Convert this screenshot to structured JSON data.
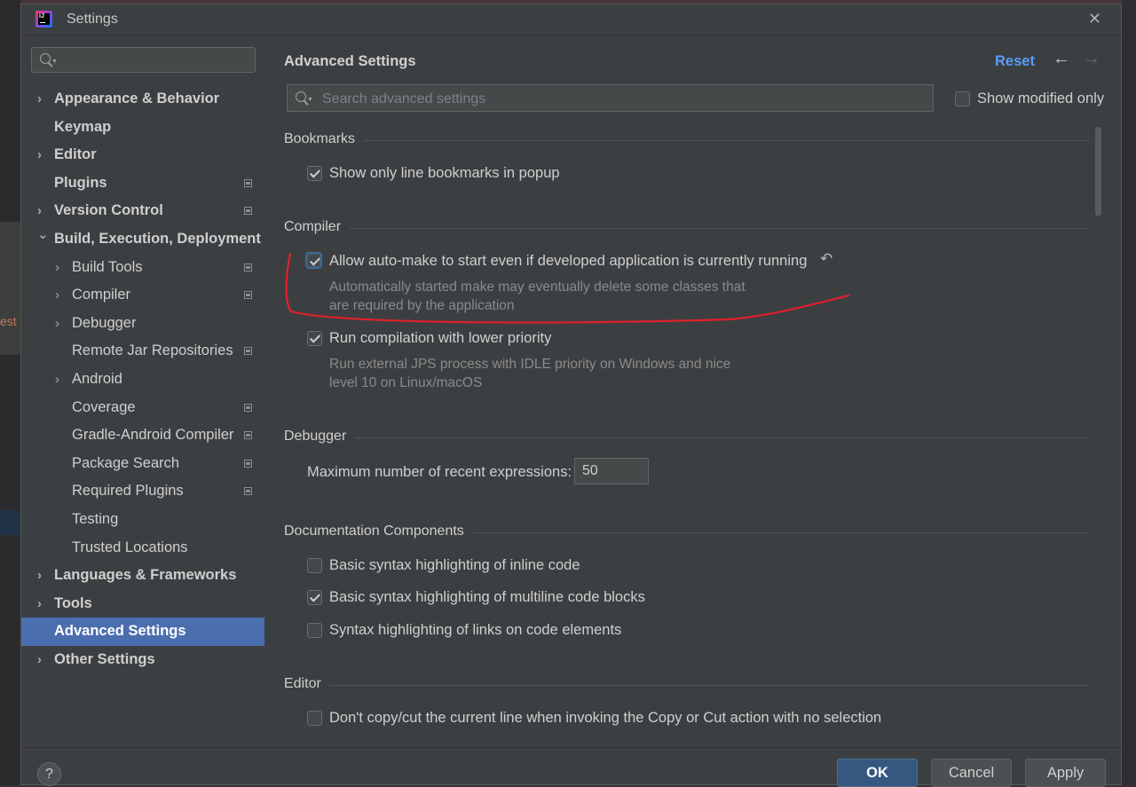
{
  "window": {
    "title": "Settings"
  },
  "icons": {
    "app": "intellij-logo-icon",
    "close": "close-icon",
    "help": "help-icon"
  },
  "sidebar": {
    "search_placeholder": "",
    "items": [
      {
        "label": "Appearance & Behavior",
        "chevron": "›",
        "bold": true,
        "level": 0,
        "project_icon": false
      },
      {
        "label": "Keymap",
        "chevron": "",
        "bold": true,
        "level": 0,
        "project_icon": false
      },
      {
        "label": "Editor",
        "chevron": "›",
        "bold": true,
        "level": 0,
        "project_icon": false
      },
      {
        "label": "Plugins",
        "chevron": "",
        "bold": true,
        "level": 0,
        "project_icon": true
      },
      {
        "label": "Version Control",
        "chevron": "›",
        "bold": true,
        "level": 0,
        "project_icon": true
      },
      {
        "label": "Build, Execution, Deployment",
        "chevron": "⌄",
        "bold": true,
        "level": 0,
        "project_icon": false
      },
      {
        "label": "Build Tools",
        "chevron": "›",
        "bold": false,
        "level": 1,
        "project_icon": true
      },
      {
        "label": "Compiler",
        "chevron": "›",
        "bold": false,
        "level": 1,
        "project_icon": true
      },
      {
        "label": "Debugger",
        "chevron": "›",
        "bold": false,
        "level": 1,
        "project_icon": false
      },
      {
        "label": "Remote Jar Repositories",
        "chevron": "",
        "bold": false,
        "level": 1,
        "project_icon": true
      },
      {
        "label": "Android",
        "chevron": "›",
        "bold": false,
        "level": 1,
        "project_icon": false
      },
      {
        "label": "Coverage",
        "chevron": "",
        "bold": false,
        "level": 1,
        "project_icon": true
      },
      {
        "label": "Gradle-Android Compiler",
        "chevron": "",
        "bold": false,
        "level": 1,
        "project_icon": true
      },
      {
        "label": "Package Search",
        "chevron": "",
        "bold": false,
        "level": 1,
        "project_icon": true
      },
      {
        "label": "Required Plugins",
        "chevron": "",
        "bold": false,
        "level": 1,
        "project_icon": true
      },
      {
        "label": "Testing",
        "chevron": "",
        "bold": false,
        "level": 1,
        "project_icon": false
      },
      {
        "label": "Trusted Locations",
        "chevron": "",
        "bold": false,
        "level": 1,
        "project_icon": false
      },
      {
        "label": "Languages & Frameworks",
        "chevron": "›",
        "bold": true,
        "level": 0,
        "project_icon": false
      },
      {
        "label": "Tools",
        "chevron": "›",
        "bold": true,
        "level": 0,
        "project_icon": false
      },
      {
        "label": "Advanced Settings",
        "chevron": "",
        "bold": true,
        "level": 0,
        "project_icon": false,
        "selected": true
      },
      {
        "label": "Other Settings",
        "chevron": "›",
        "bold": true,
        "level": 0,
        "project_icon": false
      }
    ]
  },
  "main": {
    "title": "Advanced Settings",
    "reset_label": "Reset",
    "nav_back": "←",
    "nav_forward": "→",
    "search_placeholder": "Search advanced settings",
    "show_modified_label": "Show modified only",
    "show_modified_checked": false,
    "sections": {
      "bookmarks": {
        "title": "Bookmarks",
        "options": [
          {
            "label": "Show only line bookmarks in popup",
            "checked": true
          }
        ]
      },
      "compiler": {
        "title": "Compiler",
        "options": [
          {
            "label": "Allow auto-make to start even if developed application is currently running",
            "checked": true,
            "desc1": "Automatically started make may eventually delete some classes that",
            "desc2": "are required by the application",
            "revert_icon": "↶"
          },
          {
            "label": "Run compilation with lower priority",
            "checked": true,
            "desc1": "Run external JPS process with IDLE priority on Windows and nice",
            "desc2": "level 10 on Linux/macOS"
          }
        ]
      },
      "debugger": {
        "title": "Debugger",
        "max_recent_label": "Maximum number of recent expressions:",
        "max_recent_value": "50"
      },
      "documentation": {
        "title": "Documentation Components",
        "options": [
          {
            "label": "Basic syntax highlighting of inline code",
            "checked": false
          },
          {
            "label": "Basic syntax highlighting of multiline code blocks",
            "checked": true
          },
          {
            "label": "Syntax highlighting of links on code elements",
            "checked": false
          }
        ]
      },
      "editor": {
        "title": "Editor",
        "options": [
          {
            "label": "Don't copy/cut the current line when invoking the Copy or Cut action with no selection",
            "checked": false
          }
        ]
      }
    }
  },
  "footer": {
    "help": "?",
    "ok": "OK",
    "cancel": "Cancel",
    "apply": "Apply"
  },
  "background_peek": "est",
  "colors": {
    "selection": "#4b6eaf",
    "link": "#589df6",
    "annotation": "#e0202a",
    "primary_button": "#365880"
  }
}
